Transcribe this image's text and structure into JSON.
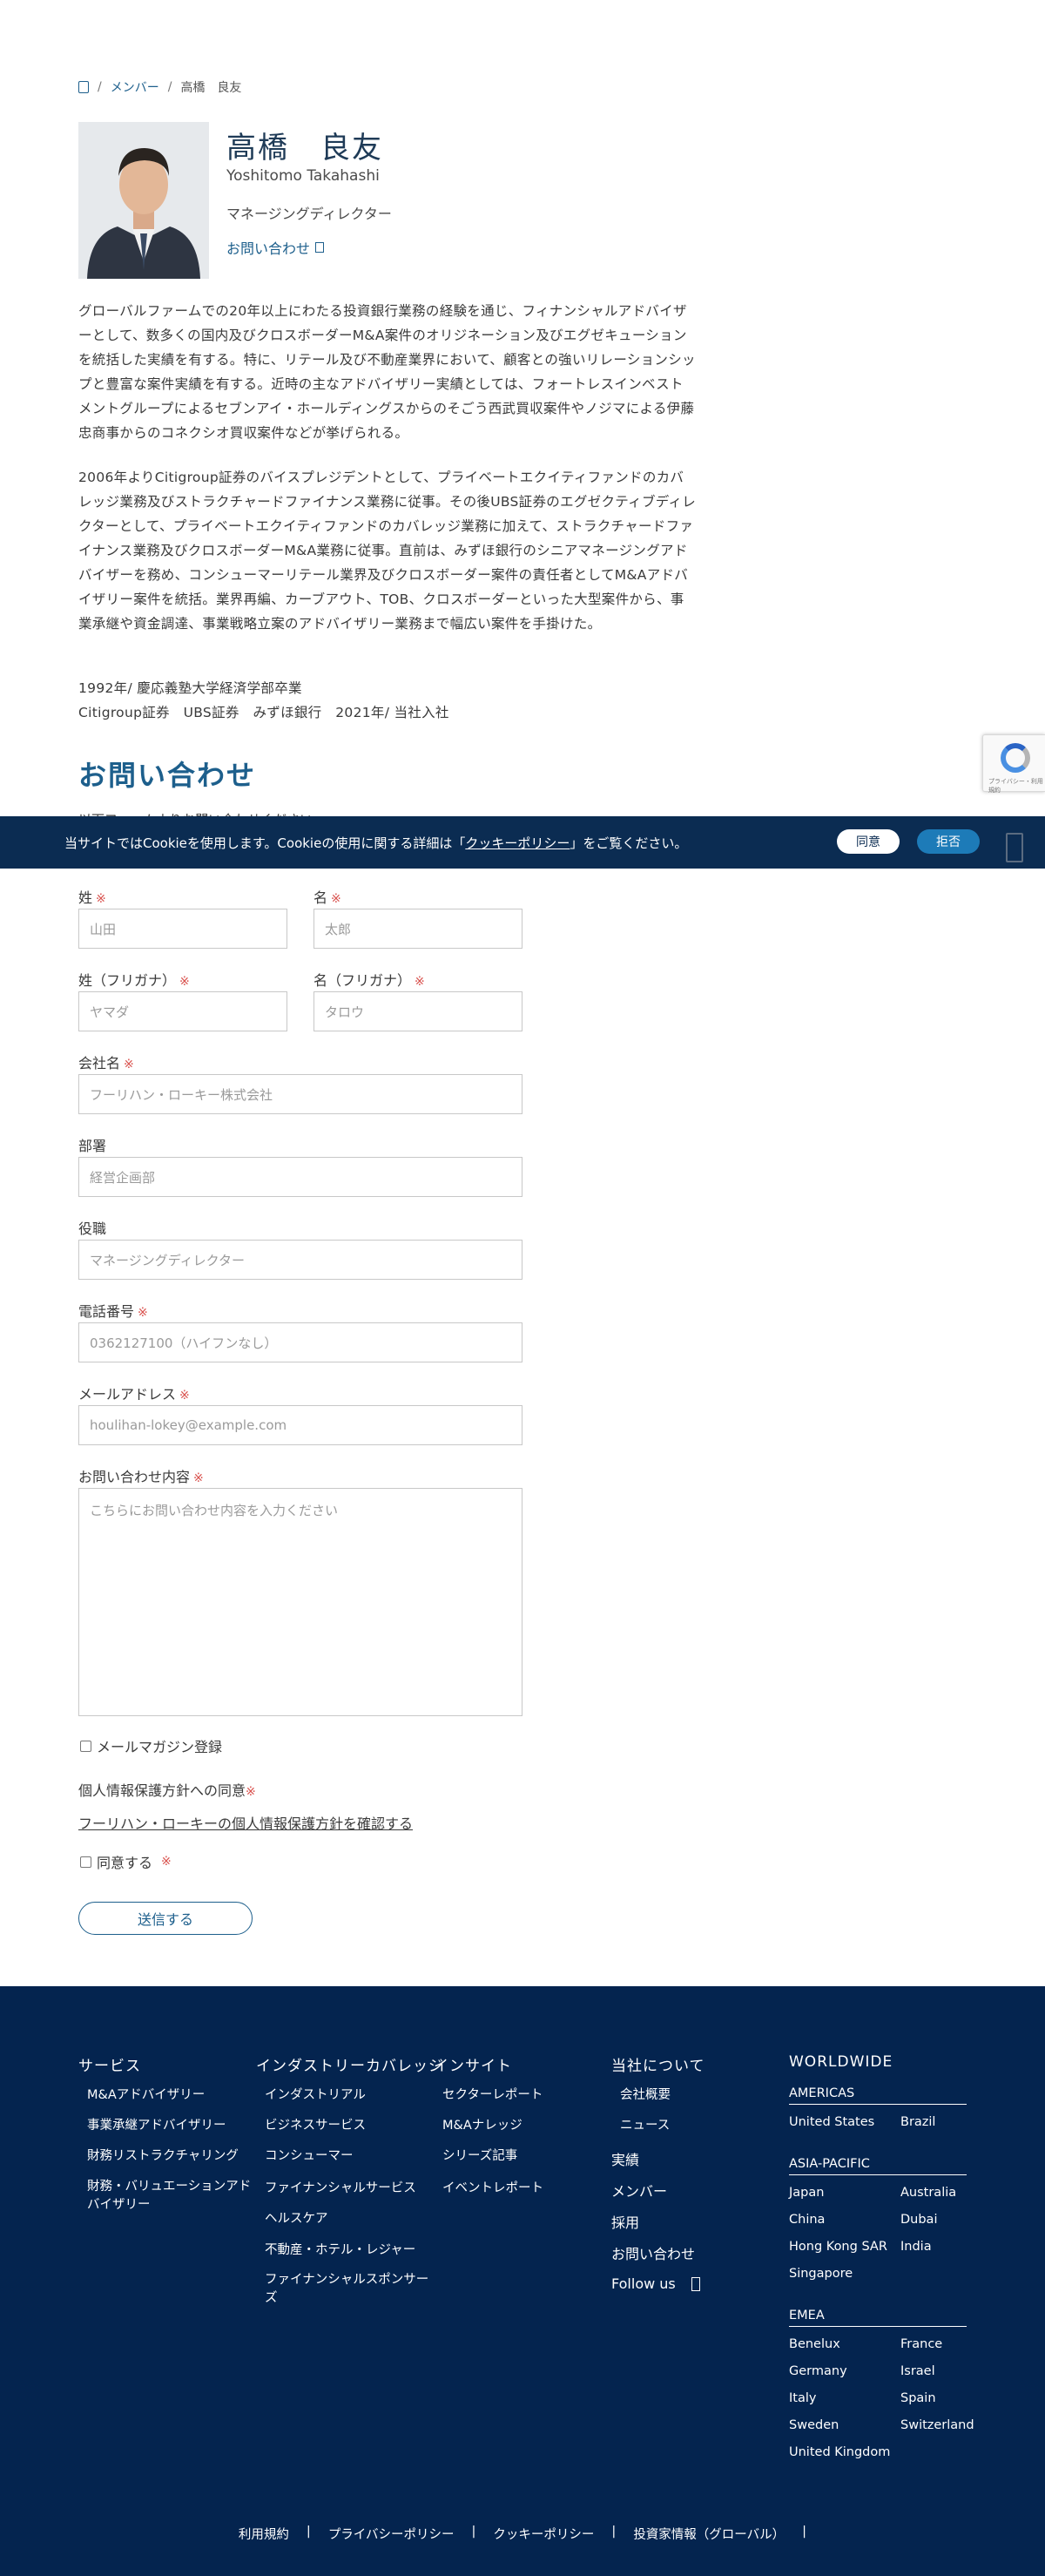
{
  "breadcrumb": {
    "items": [
      "メンバー",
      "高橋　良友"
    ]
  },
  "profile": {
    "name_ja": "高橋　良友",
    "name_en": "Yoshitomo Takahashi",
    "title": "マネージングディレクター",
    "contact_link": "お問い合わせ",
    "bio": [
      "グローバルファームでの20年以上にわたる投資銀行業務の経験を通じ、フィナンシャルアドバイザーとして、数多くの国内及びクロスボーダーM&A案件のオリジネーション及びエグゼキューションを統括した実績を有する。特に、リテール及び不動産業界において、顧客との強いリレーションシップと豊富な案件実績を有する。近時の主なアドバイザリー実績としては、フォートレスインベストメントグループによるセブンアイ・ホールディングスからのそごう西武買収案件やノジマによる伊藤忠商事からのコネクシオ買収案件などが挙げられる。",
      "2006年よりCitigroup証券のバイスプレジデントとして、プライベートエクイティファンドのカバレッジ業務及びストラクチャードファイナンス業務に従事。その後UBS証券のエグゼクティブディレクターとして、プライベートエクイティファンドのカバレッジ業務に加えて、ストラクチャードファイナンス業務及びクロスボーダーM&A業務に従事。直前は、みずほ銀行のシニアマネージングアドバイザーを務め、コンシューマーリテール業界及びクロスボーダー案件の責任者としてM&Aアドバイザリー案件を統括。業界再編、カーブアウト、TOB、クロスボーダーといった大型案件から、事業承継や資金調達、事業戦略立案のアドバイザリー業務まで幅広い案件を手掛けた。",
      "1992年/ 慶応義塾大学経済学部卒業",
      "Citigroup証券　UBS証券　みずほ銀行　2021年/ 当社入社"
    ]
  },
  "contact_section": {
    "title": "お問い合わせ",
    "subtitle": "以下フォームよりお問い合わせください。"
  },
  "cookie": {
    "text_before": "当サイトではCookieを使用します。Cookieの使用に関する詳細は「",
    "policy_link": "クッキーポリシー",
    "text_after": "」をご覧ください。",
    "agree": "同意",
    "deny": "拒否"
  },
  "recaptcha": {
    "text": "プライバシー・利用規約"
  },
  "form": {
    "required_mark": "※",
    "last_name": {
      "label": "姓",
      "placeholder": "山田"
    },
    "first_name": {
      "label": "名",
      "placeholder": "太郎"
    },
    "last_name_kana": {
      "label": "姓（フリガナ）",
      "placeholder": "ヤマダ"
    },
    "first_name_kana": {
      "label": "名（フリガナ）",
      "placeholder": "タロウ"
    },
    "company": {
      "label": "会社名",
      "placeholder": "フーリハン・ローキー株式会社"
    },
    "department": {
      "label": "部署",
      "placeholder": "経営企画部"
    },
    "position": {
      "label": "役職",
      "placeholder": "マネージングディレクター"
    },
    "phone": {
      "label": "電話番号",
      "placeholder": "0362127100（ハイフンなし）"
    },
    "email": {
      "label": "メールアドレス",
      "placeholder": "houlihan-lokey@example.com"
    },
    "message": {
      "label": "お問い合わせ内容",
      "placeholder": "こちらにお問い合わせ内容を入力ください"
    },
    "newsletter": "メールマガジン登録",
    "privacy_heading": "個人情報保護方針への同意",
    "privacy_link": "フーリハン・ローキーの個人情報保護方針を確認する",
    "agree": "同意する",
    "submit": "送信する"
  },
  "footer": {
    "services": {
      "heading": "サービス",
      "items": [
        "M&Aアドバイザリー",
        "事業承継アドバイザリー",
        "財務リストラクチャリング",
        "財務・バリュエーションアドバイザリー"
      ]
    },
    "industry": {
      "heading": "インダストリーカバレッジ",
      "items": [
        "インダストリアル",
        "ビジネスサービス",
        "コンシューマー",
        "ファイナンシャルサービス",
        "ヘルスケア",
        "不動産・ホテル・レジャー",
        "ファイナンシャルスポンサーズ"
      ]
    },
    "insights": {
      "heading": "インサイト",
      "items": [
        "セクターレポート",
        "M&Aナレッジ",
        "シリーズ記事",
        "イベントレポート"
      ]
    },
    "about": {
      "heading": "当社について",
      "items": [
        "会社概要",
        "ニュース"
      ],
      "links": [
        "実績",
        "メンバー",
        "採用",
        "お問い合わせ"
      ],
      "follow": "Follow us"
    },
    "worldwide": {
      "heading": "WORLDWIDE",
      "americas": {
        "label": "AMERICAS",
        "countries": [
          "United States",
          "Brazil"
        ]
      },
      "apac": {
        "label": "ASIA-PACIFIC",
        "countries": [
          "Japan",
          "Australia",
          "China",
          "Dubai",
          "Hong Kong SAR",
          "India",
          "Singapore"
        ]
      },
      "emea": {
        "label": "EMEA",
        "countries": [
          "Benelux",
          "France",
          "Germany",
          "Israel",
          "Italy",
          "Spain",
          "Sweden",
          "Switzerland",
          "United Kingdom"
        ]
      }
    },
    "bottom_links": [
      "利用規約",
      "プライバシーポリシー",
      "クッキーポリシー",
      "投資家情報（グローバル）"
    ]
  }
}
